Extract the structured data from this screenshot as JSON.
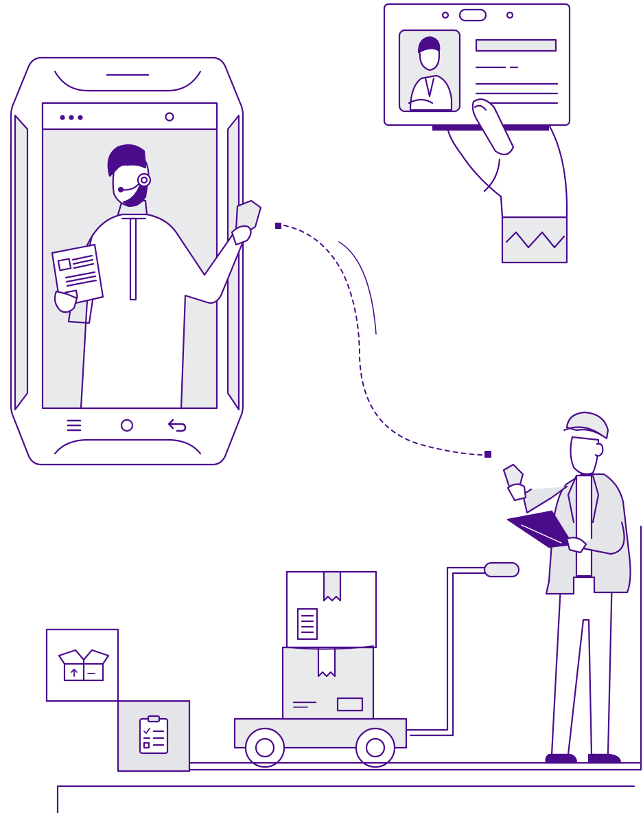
{
  "palette": {
    "ink": "#4b0c8c",
    "fill_gray": "#e9eaec",
    "panel_gray": "#e4e5e8",
    "background": "#ffffff"
  },
  "scene": {
    "phone": {
      "status_icons": [
        "dots-icon",
        "camera-icon"
      ],
      "nav_icons": [
        "menu-icon",
        "home-icon",
        "back-icon"
      ],
      "agent": {
        "headset": true,
        "holding": "document",
        "holding_right": "scanner"
      }
    },
    "id_card": {
      "holder_icon": "badge-photo-icon"
    },
    "connection": {
      "style": "dashed",
      "endpoints": [
        "phone",
        "worker"
      ]
    },
    "worker": {
      "helmet": true,
      "holding": [
        "scanner",
        "clipboard"
      ]
    },
    "trolley": {
      "boxes": 2
    },
    "side_tiles": [
      {
        "icon": "open-box-icon"
      },
      {
        "icon": "checklist-icon"
      }
    ]
  }
}
